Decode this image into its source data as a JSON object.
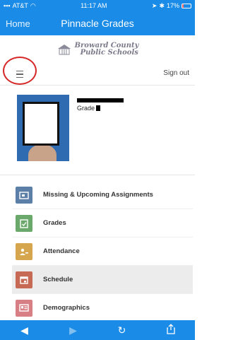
{
  "status_bar": {
    "carrier": "AT&T",
    "time": "11:17 AM",
    "battery": "17%",
    "battery_fraction": 0.17
  },
  "nav": {
    "home_label": "Home",
    "title": "Pinnacle Grades"
  },
  "logo": {
    "line1": "Broward County",
    "line2": "Public Schools"
  },
  "toolbar": {
    "signout_label": "Sign out"
  },
  "profile": {
    "grade_label": "Grade"
  },
  "menu": {
    "items": [
      {
        "label": "Missing & Upcoming Assignments",
        "icon": "assignments-icon",
        "color": "#5b7fa6"
      },
      {
        "label": "Grades",
        "icon": "grades-icon",
        "color": "#6ba86b"
      },
      {
        "label": "Attendance",
        "icon": "attendance-icon",
        "color": "#d6a64e"
      },
      {
        "label": "Schedule",
        "icon": "calendar-icon",
        "color": "#c76a55"
      },
      {
        "label": "Demographics",
        "icon": "id-card-icon",
        "color": "#d87f86"
      }
    ]
  },
  "colors": {
    "primary": "#1a8be6",
    "highlight_circle": "#d62a2a"
  }
}
